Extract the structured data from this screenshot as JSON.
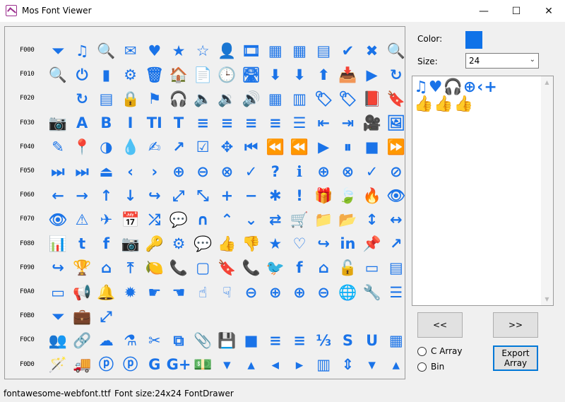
{
  "window": {
    "title": "Mos Font Viewer",
    "minimize_glyph": "—",
    "maximize_glyph": "☐",
    "close_glyph": "✕"
  },
  "glyph_panel": {
    "accent_color": "#1a73e8",
    "rows": [
      {
        "label": "F000",
        "glyphs": [
          "⏷",
          "♫",
          "🔍",
          "✉",
          "♥",
          "★",
          "☆",
          "👤",
          "🎞",
          "▦",
          "▦",
          "▤",
          "✔",
          "✖",
          "🔍"
        ]
      },
      {
        "label": "F010",
        "glyphs": [
          "🔍",
          "⏻",
          "▮",
          "⚙",
          "🗑",
          "🏠",
          "📄",
          "🕒",
          "🛣",
          "⬇",
          "⬇",
          "⬆",
          "📥",
          "▶",
          "↻"
        ]
      },
      {
        "label": "F020",
        "glyphs": [
          "",
          "↻",
          "▤",
          "🔒",
          "⚑",
          "🎧",
          "🔈",
          "🔉",
          "🔊",
          "▦",
          "▥",
          "🏷",
          "🏷",
          "📕",
          "🔖"
        ]
      },
      {
        "label": "F030",
        "glyphs": [
          "📷",
          "A",
          "B",
          "I",
          "TI",
          "T",
          "≡",
          "≡",
          "≡",
          "≡",
          "☰",
          "⇤",
          "⇥",
          "🎥",
          "🖼"
        ]
      },
      {
        "label": "F040",
        "glyphs": [
          "✎",
          "📍",
          "◑",
          "💧",
          "✍",
          "↗",
          "☑",
          "✥",
          "⏮",
          "⏪",
          "⏪",
          "▶",
          "⏸",
          "■",
          "⏩"
        ]
      },
      {
        "label": "F050",
        "glyphs": [
          "⏭",
          "⏭",
          "⏏",
          "‹",
          "›",
          "⊕",
          "⊖",
          "⊗",
          "✓",
          "?",
          "ℹ",
          "⊕",
          "⊗",
          "✓",
          "⊘"
        ]
      },
      {
        "label": "F060",
        "glyphs": [
          "←",
          "→",
          "↑",
          "↓",
          "↪",
          "⤢",
          "⤡",
          "+",
          "−",
          "✱",
          "!",
          "🎁",
          "🍃",
          "🔥",
          "👁"
        ]
      },
      {
        "label": "F070",
        "glyphs": [
          "👁",
          "⚠",
          "✈",
          "📅",
          "⤮",
          "💬",
          "∩",
          "⌃",
          "⌄",
          "⇄",
          "🛒",
          "📁",
          "📂",
          "↕",
          "↔"
        ]
      },
      {
        "label": "F080",
        "glyphs": [
          "📊",
          "t",
          "f",
          "📷",
          "🔑",
          "⚙",
          "💬",
          "👍",
          "👎",
          "★",
          "♡",
          "↪",
          "in",
          "📌",
          "↗"
        ]
      },
      {
        "label": "F090",
        "glyphs": [
          "↪",
          "🏆",
          "⌂",
          "⤒",
          "🍋",
          "📞",
          "▢",
          "🔖",
          "📞",
          "🐦",
          "f",
          "⌂",
          "🔓",
          "▭",
          "▤"
        ]
      },
      {
        "label": "F0A0",
        "glyphs": [
          "▭",
          "📢",
          "🔔",
          "✹",
          "☛",
          "☚",
          "☝",
          "☟",
          "⊖",
          "⊕",
          "⊕",
          "⊖",
          "🌐",
          "🔧",
          "☰"
        ]
      },
      {
        "label": "F0B0",
        "glyphs": [
          "⏷",
          "💼",
          "⤢",
          "",
          "",
          "",
          "",
          "",
          "",
          "",
          "",
          "",
          "",
          "",
          ""
        ]
      },
      {
        "label": "F0C0",
        "glyphs": [
          "👥",
          "🔗",
          "☁",
          "⚗",
          "✂",
          "⧉",
          "📎",
          "💾",
          "■",
          "≡",
          "≡",
          "⅓",
          "S",
          "U",
          "▦"
        ]
      },
      {
        "label": "F0D0",
        "glyphs": [
          "🪄",
          "🚚",
          "ⓟ",
          "ⓟ",
          "G",
          "G+",
          "💵",
          "▾",
          "▴",
          "◂",
          "▸",
          "▥",
          "⇕",
          "▾",
          "▴"
        ]
      }
    ]
  },
  "controls": {
    "color_label": "Color:",
    "color_value": "#0f72e8",
    "size_label": "Size:",
    "size_value": "24",
    "size_chevron": "⌄"
  },
  "preview": {
    "line1": "♫♥🎧⊕‹+",
    "line2": "👍👍👍",
    "scroll_up": "▲",
    "scroll_down": "▼"
  },
  "buttons": {
    "prev_label": "<<",
    "next_label": ">>",
    "export_line1": "Export",
    "export_line2": "Array"
  },
  "radios": {
    "c_array_label": "C Array",
    "bin_label": "Bin"
  },
  "status": {
    "font_file": "fontawesome-webfont.ttf",
    "font_size": "Font size:24x24",
    "drawer": "FontDrawer"
  }
}
